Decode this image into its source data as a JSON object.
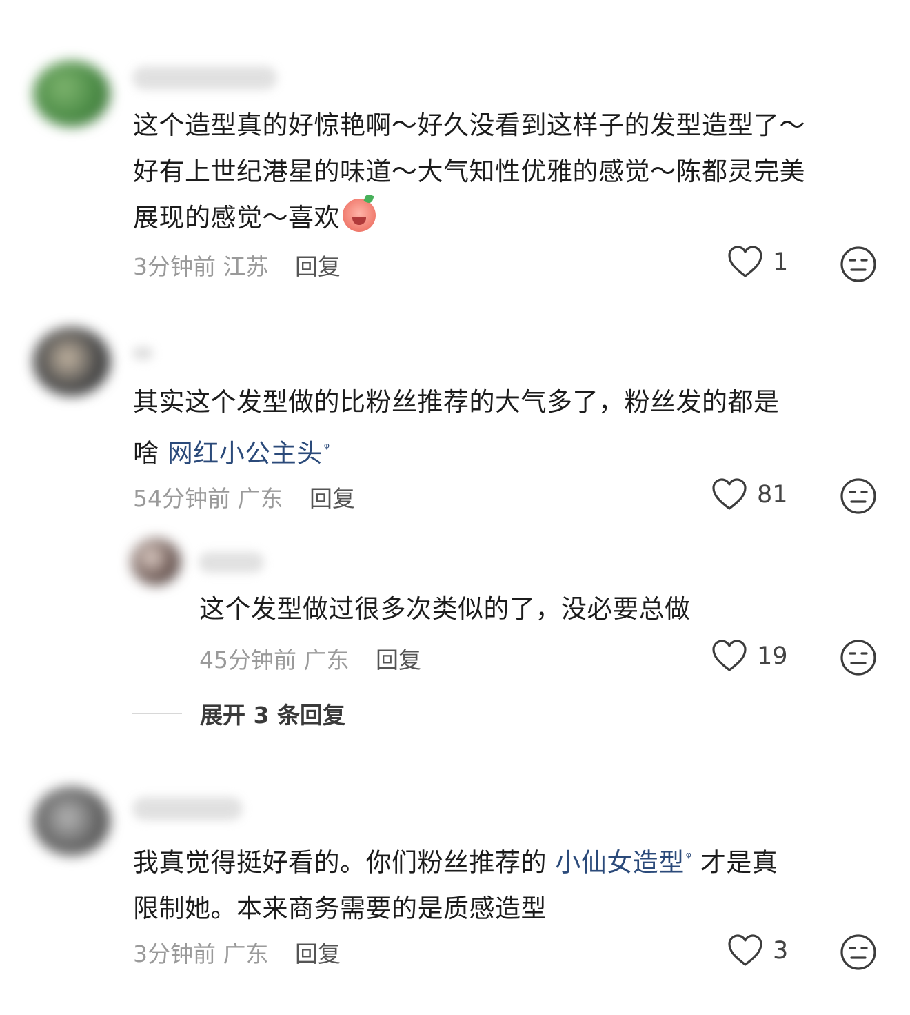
{
  "comments": [
    {
      "text_line1": "这个造型真的好惊艳啊～好久没看到这样子的发型造型了～",
      "text_line2": "好有上世纪港星的味道～大气知性优雅的感觉～陈都灵完美",
      "text_line3": "展现的感觉～喜欢",
      "time": "3分钟前",
      "location": "江苏",
      "reply": "回复",
      "likes": "1"
    },
    {
      "text_line1": "其实这个发型做的比粉丝推荐的大气多了，粉丝发的都是",
      "text_line2_prefix": "啥 ",
      "text_line2_link": "网红小公主头",
      "time": "54分钟前",
      "location": "广东",
      "reply": "回复",
      "likes": "81",
      "subreply": {
        "text": "这个发型做过很多次类似的了，没必要总做",
        "time": "45分钟前",
        "location": "广东",
        "reply": "回复",
        "likes": "19"
      },
      "expand_label": "展开 3 条回复"
    },
    {
      "text_line1_prefix": "我真觉得挺好看的。你们粉丝推荐的 ",
      "text_line1_link": "小仙女造型",
      "text_line1_suffix": " 才是真",
      "text_line2": "限制她。本来商务需要的是质感造型",
      "time": "3分钟前",
      "location": "广东",
      "reply": "回复",
      "likes": "3"
    }
  ],
  "search_mark": "ᵠ",
  "colors": {
    "link": "#2b4a7a",
    "meta": "#9a9a9a",
    "text": "#1c1c1c"
  },
  "icons": [
    "heart-icon",
    "dislike-face-icon",
    "emoji-sticker-icon",
    "search-icon"
  ]
}
